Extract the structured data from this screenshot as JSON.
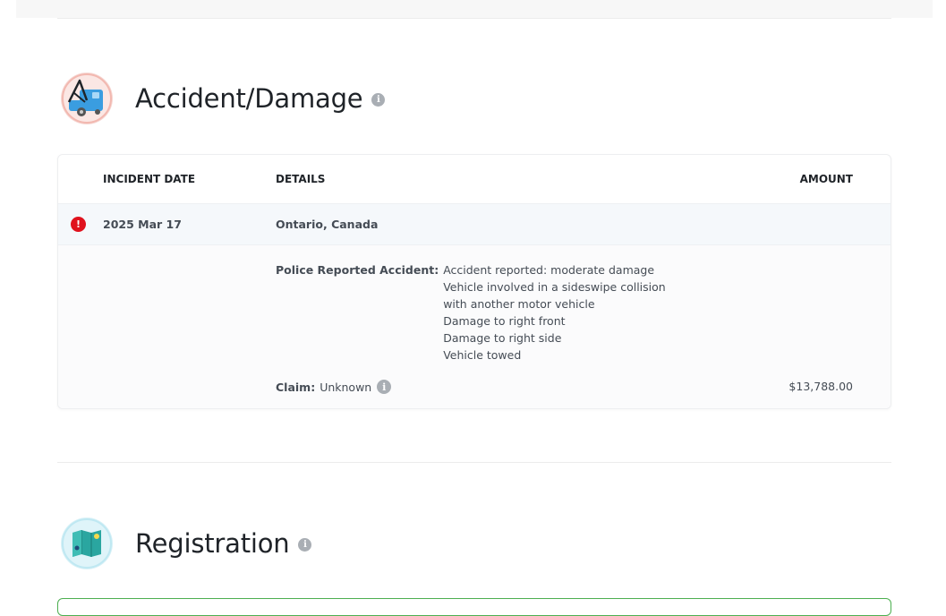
{
  "accident_section": {
    "title": "Accident/Damage",
    "info_icon": "info-icon",
    "section_icon": "tow-truck-icon"
  },
  "table": {
    "headers": {
      "incident_date": "INCIDENT DATE",
      "details": "DETAILS",
      "amount": "AMOUNT"
    },
    "row": {
      "status_icon": "alert-icon",
      "status_color": "#e0121d",
      "date": "2025 Mar 17",
      "location": "Ontario, Canada",
      "detail_label": "Police Reported Accident:",
      "detail_lines": [
        "Accident reported: moderate damage",
        "Vehicle involved in a sideswipe collision",
        "with another motor vehicle",
        "Damage to right front",
        "Damage to right side",
        "Vehicle towed"
      ],
      "claim_label": "Claim:",
      "claim_value": "Unknown",
      "amount": "$13,788.00"
    }
  },
  "registration_section": {
    "title": "Registration",
    "info_icon": "info-icon",
    "section_icon": "map-icon"
  }
}
